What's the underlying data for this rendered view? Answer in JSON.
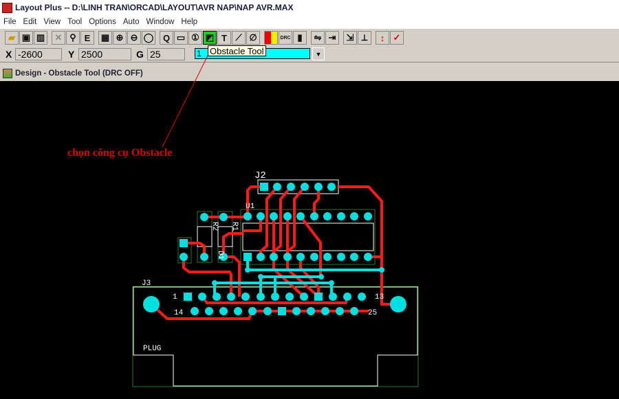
{
  "window": {
    "title": "Layout Plus -- D:\\LINH TRAN\\ORCAD\\LAYOUT\\AVR NAP\\NAP AVR.MAX"
  },
  "menu": [
    "File",
    "Edit",
    "View",
    "Tool",
    "Options",
    "Auto",
    "Window",
    "Help"
  ],
  "toolbar": {
    "tooltip": "Obstacle Tool"
  },
  "coords": {
    "x_label": "X",
    "x": "-2600",
    "y_label": "Y",
    "y": "2500",
    "g_label": "G",
    "g": "25",
    "layer": "1"
  },
  "document": {
    "title": "Design - Obstacle Tool (DRC OFF)"
  },
  "annotation": "chọn công cụ Obstacle",
  "pcb": {
    "j2": "J2",
    "u1": "U1",
    "r1": "R1",
    "r2": "R2",
    "d1": "D1",
    "j3": "J3",
    "pin1": "1",
    "pin13": "13",
    "pin14": "14",
    "pin25": "25",
    "plug": "PLUG"
  },
  "colors": {
    "pad": "#00e0e0",
    "trace": "#ff1a1a",
    "outline": "#ffffff",
    "footprint": "#2a7a2a"
  }
}
